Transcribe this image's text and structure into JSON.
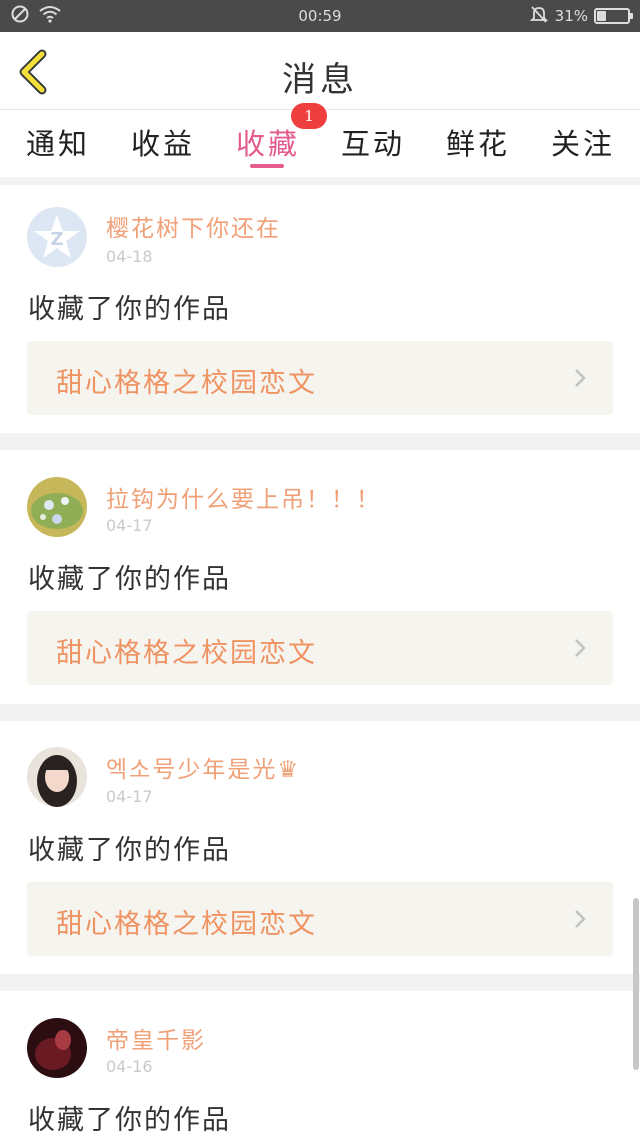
{
  "status_bar": {
    "time": "00:59",
    "battery_text": "31%",
    "battery_level": 0.31
  },
  "header": {
    "title": "消息"
  },
  "tabs": [
    {
      "label": "通知"
    },
    {
      "label": "收益"
    },
    {
      "label": "收藏",
      "active": true,
      "badge": "1"
    },
    {
      "label": "互动"
    },
    {
      "label": "鲜花"
    },
    {
      "label": "关注"
    }
  ],
  "feed": [
    {
      "user": "樱花树下你还在",
      "date": "04-18",
      "action": "收藏了你的作品",
      "work": "甜心格格之校园恋文"
    },
    {
      "user": "拉钩为什么要上吊！！！",
      "date": "04-17",
      "action": "收藏了你的作品",
      "work": "甜心格格之校园恋文"
    },
    {
      "user": "엑소号少年是光♛",
      "date": "04-17",
      "action": "收藏了你的作品",
      "work": "甜心格格之校园恋文"
    },
    {
      "user": "帝皇千影",
      "date": "04-16",
      "action": "收藏了你的作品"
    }
  ],
  "colors": {
    "accent_pink": "#e45b8e",
    "username_orange": "#f0a077",
    "work_title_orange": "#ef9363",
    "badge_red": "#ef3e3e",
    "back_arrow_yellow": "#f4e03a"
  }
}
